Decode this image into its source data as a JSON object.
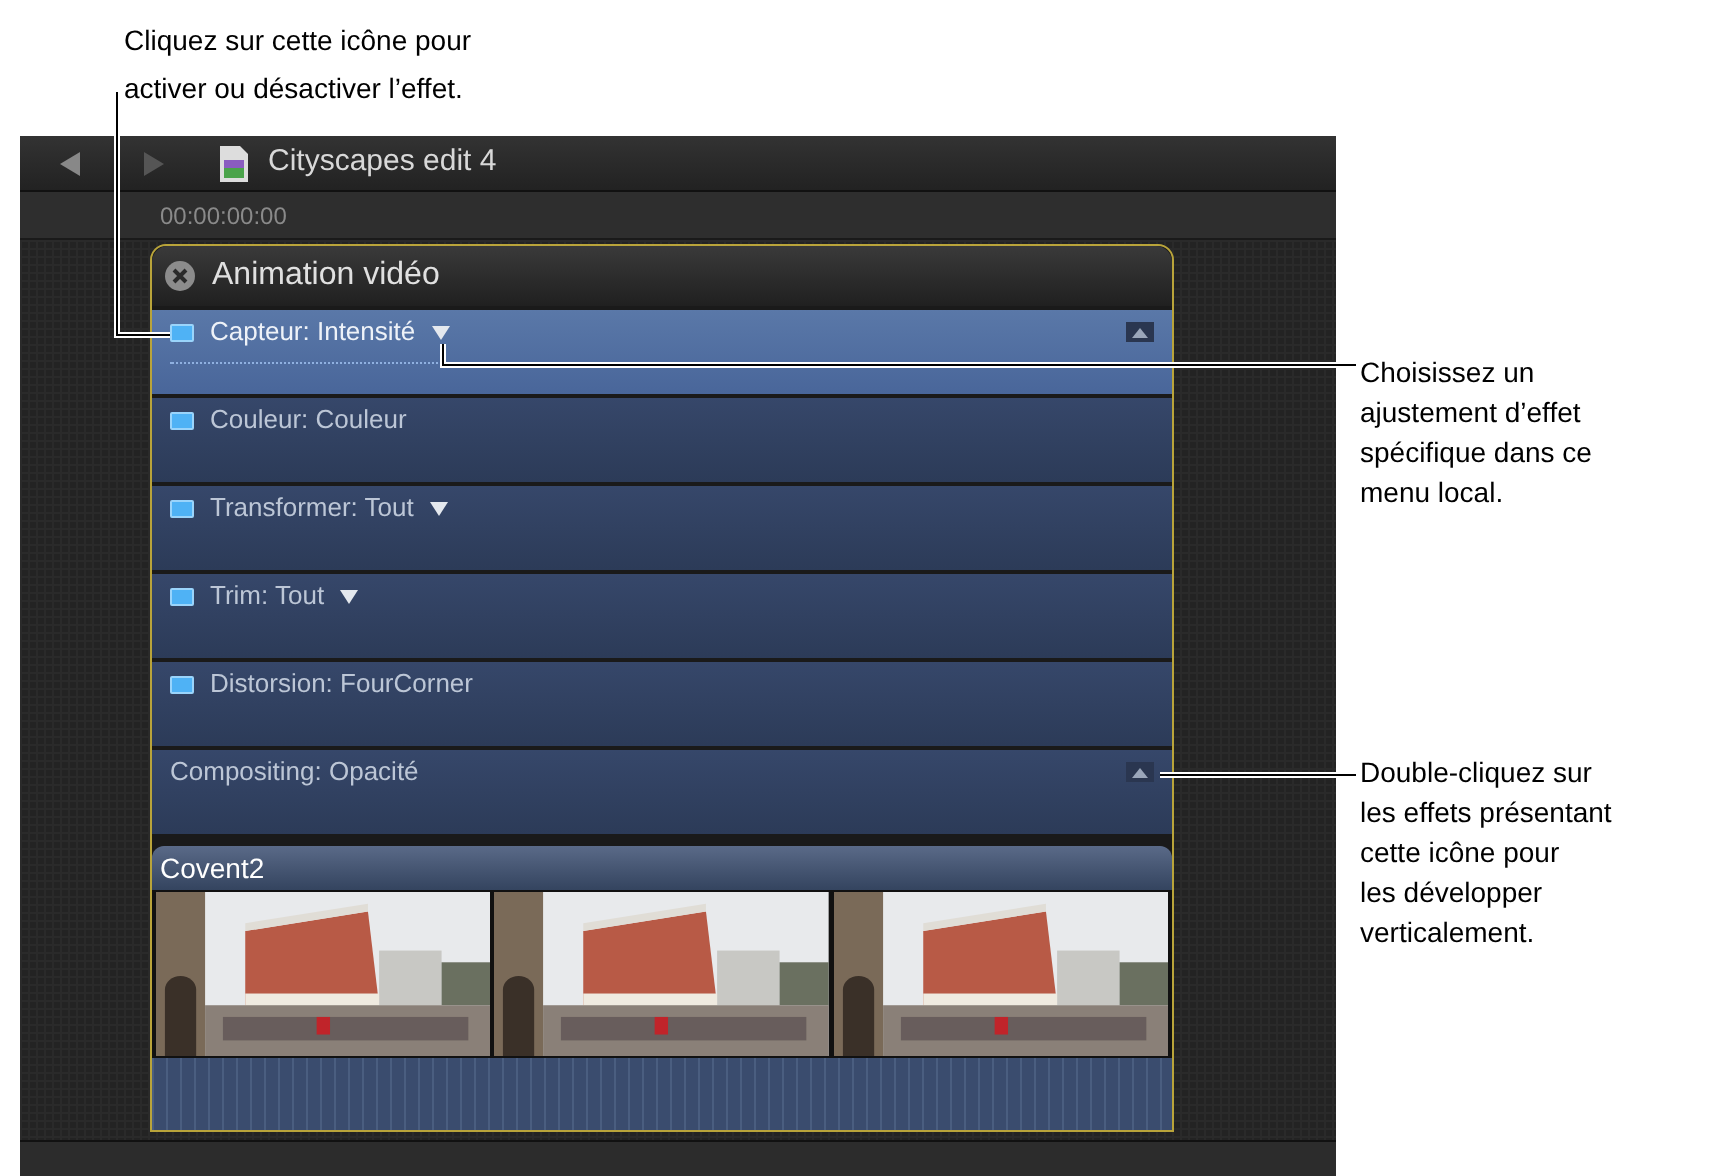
{
  "callouts": [
    {
      "lines": [
        "Cliquez sur cette icône pour",
        "activer ou désactiver l’effet."
      ]
    },
    {
      "lines": [
        "Choisissez un",
        "ajustement d’effet",
        "spécifique dans ce",
        "menu local."
      ]
    },
    {
      "lines": [
        "Double-cliquez sur",
        "les effets présentant",
        "cette icône pour",
        "les développer",
        "verticalement."
      ]
    }
  ],
  "window": {
    "title": "Cityscapes edit 4",
    "timecode": "00:00:00:00"
  },
  "effects_panel": {
    "title": "Animation vidéo",
    "rows": [
      {
        "label": "Capteur: Intensité",
        "kind": "toggle",
        "checked": true,
        "menu": true,
        "expandable": true,
        "selected": true
      },
      {
        "label": "Couleur: Couleur",
        "kind": "toggle",
        "checked": true,
        "menu": false,
        "expandable": false,
        "selected": false
      },
      {
        "label": "Transformer: Tout",
        "kind": "toggle",
        "checked": true,
        "menu": true,
        "expandable": false,
        "selected": false
      },
      {
        "label": "Trim: Tout",
        "kind": "toggle",
        "checked": true,
        "menu": true,
        "expandable": false,
        "selected": false
      },
      {
        "label": "Distorsion: FourCorner",
        "kind": "toggle",
        "checked": true,
        "menu": false,
        "expandable": false,
        "selected": false
      },
      {
        "label": "Compositing: Opacité",
        "kind": "fixed",
        "menu": false,
        "expandable": true,
        "selected": false
      }
    ]
  },
  "clip": {
    "title": "Covent2"
  }
}
